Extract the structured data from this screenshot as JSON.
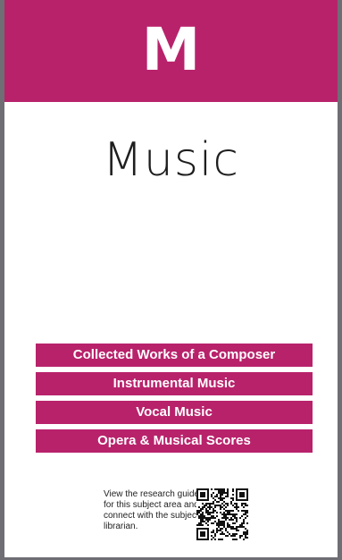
{
  "header": {
    "logo_letter": "M"
  },
  "title": "Music",
  "categories": [
    "Collected Works of a Composer",
    "Instrumental Music",
    "Vocal Music",
    "Opera & Musical Scores"
  ],
  "footer": {
    "text": "View the research guide for this subject area and connect with the subject librarian."
  },
  "colors": {
    "brand": "#b8226b",
    "background": "#ffffff",
    "frame": "#6e6e74"
  },
  "icons": {
    "qr": "qr-code-icon"
  }
}
